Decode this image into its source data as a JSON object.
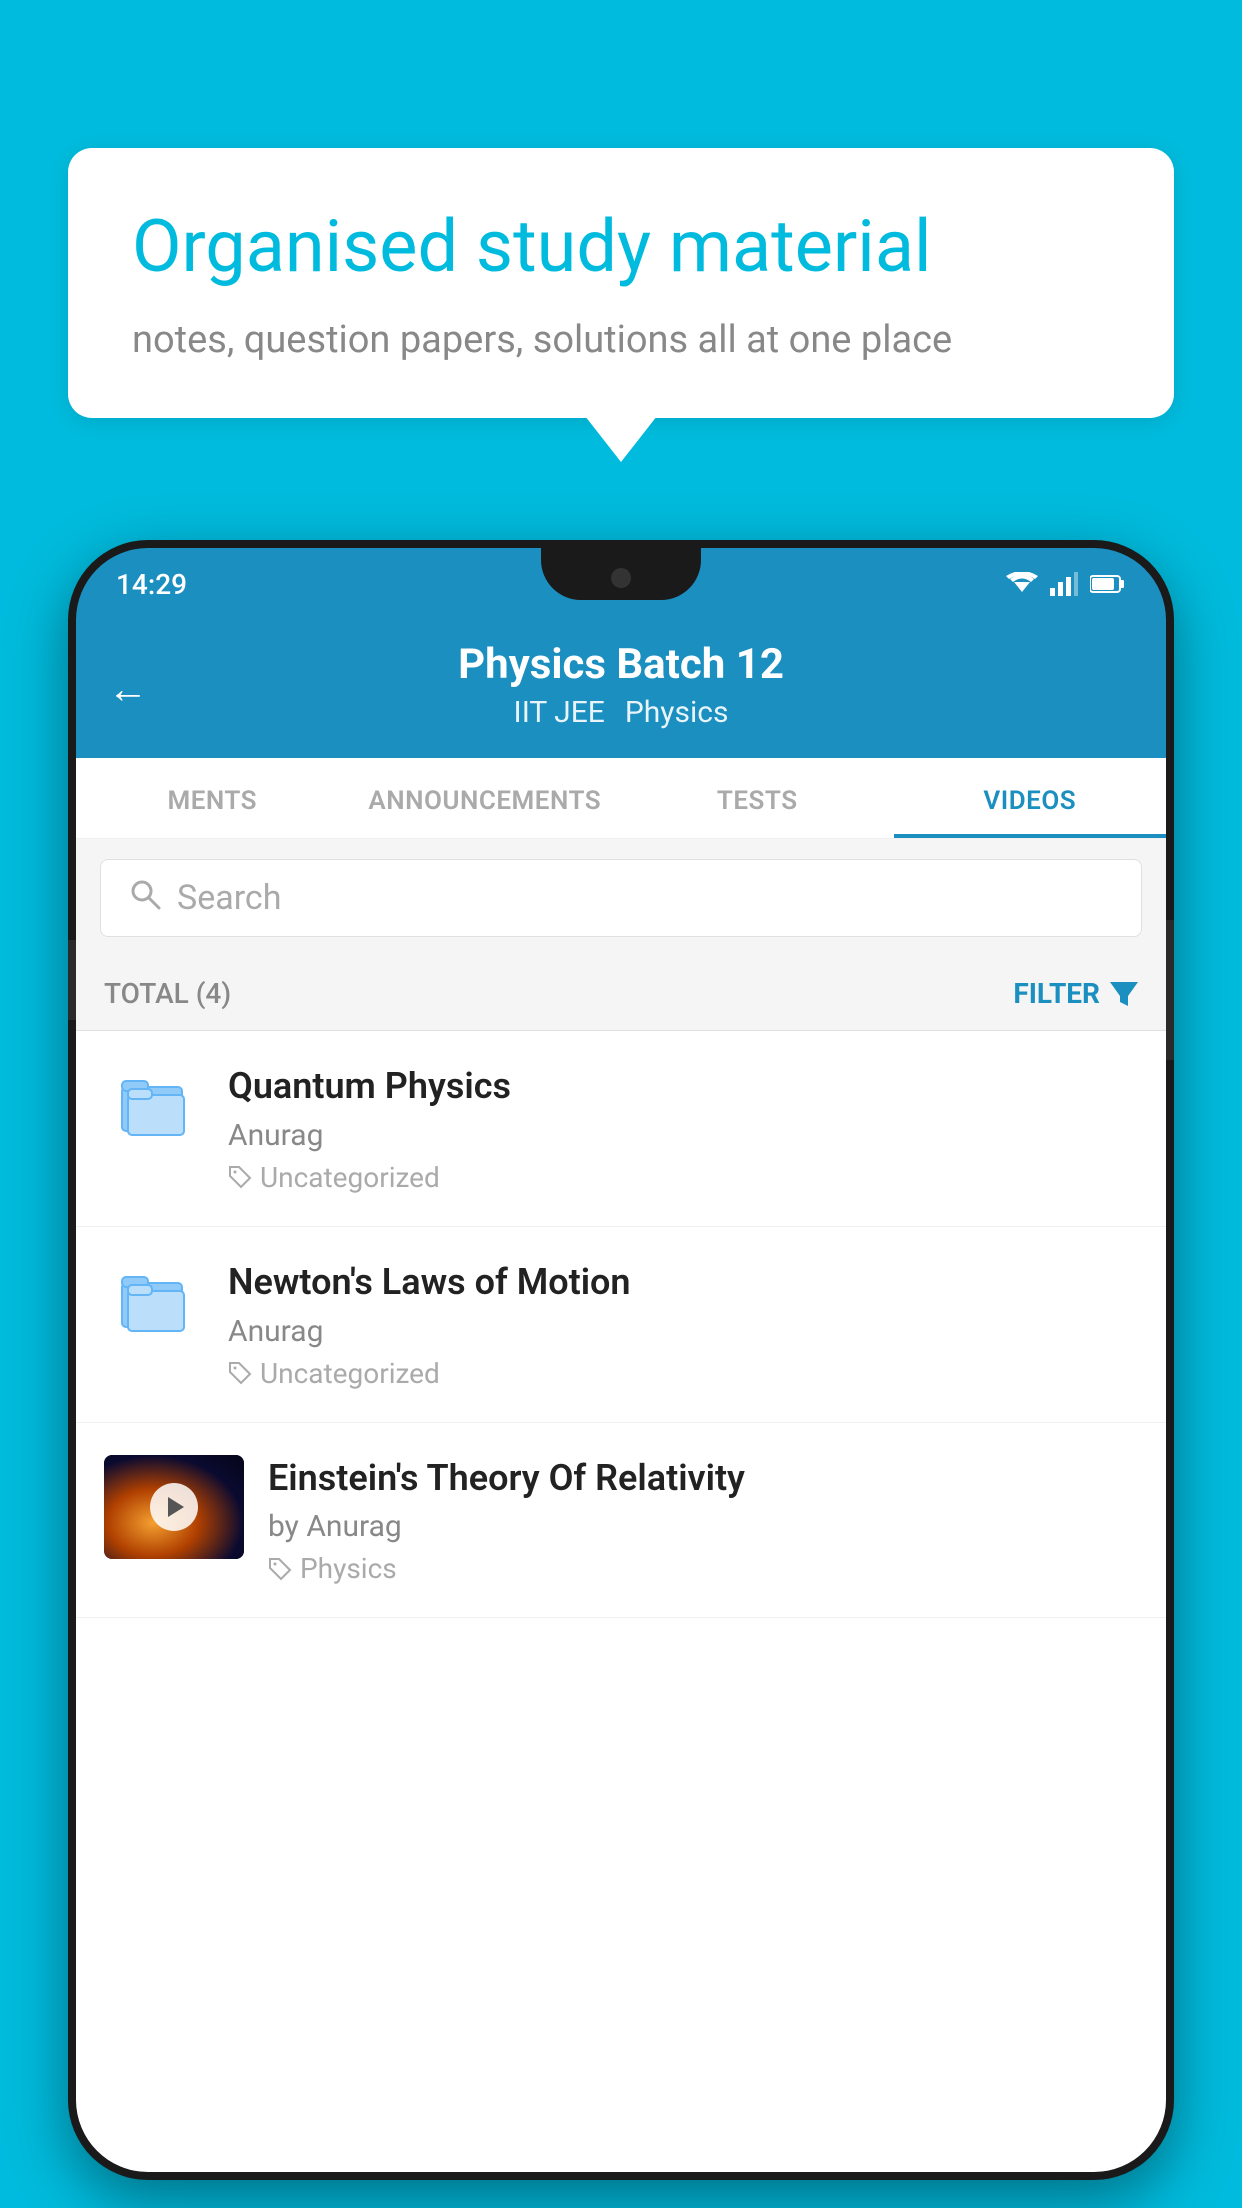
{
  "background_color": "#00BBDD",
  "bubble": {
    "title": "Organised study material",
    "subtitle": "notes, question papers, solutions all at one place"
  },
  "status_bar": {
    "time": "14:29",
    "wifi_icon": "wifi",
    "signal_icon": "signal",
    "battery_icon": "battery"
  },
  "header": {
    "back_label": "←",
    "title": "Physics Batch 12",
    "subtitle_part1": "IIT JEE",
    "subtitle_part2": "Physics"
  },
  "tabs": [
    {
      "label": "MENTS",
      "active": false
    },
    {
      "label": "ANNOUNCEMENTS",
      "active": false
    },
    {
      "label": "TESTS",
      "active": false
    },
    {
      "label": "VIDEOS",
      "active": true
    }
  ],
  "search": {
    "placeholder": "Search"
  },
  "filter_bar": {
    "total_label": "TOTAL (4)",
    "filter_label": "FILTER"
  },
  "videos": [
    {
      "title": "Quantum Physics",
      "author": "Anurag",
      "tag": "Uncategorized",
      "type": "folder",
      "has_thumb": false
    },
    {
      "title": "Newton's Laws of Motion",
      "author": "Anurag",
      "tag": "Uncategorized",
      "type": "folder",
      "has_thumb": false
    },
    {
      "title": "Einstein's Theory Of Relativity",
      "author": "by Anurag",
      "tag": "Physics",
      "type": "video",
      "has_thumb": true
    }
  ]
}
